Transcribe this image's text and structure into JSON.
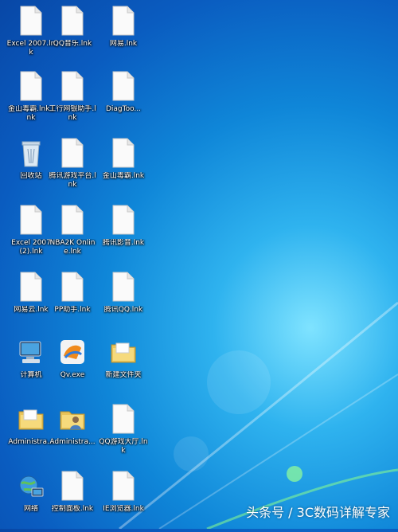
{
  "desktop": {
    "icons": [
      {
        "label": "Excel 2007.lnk",
        "icon": "blank-file-icon"
      },
      {
        "label": "QQ音乐.lnk",
        "icon": "blank-file-icon"
      },
      {
        "label": "网易.lnk",
        "icon": "blank-file-icon"
      },
      {
        "label": "金山毒霸.lnk.lnk",
        "icon": "blank-file-icon"
      },
      {
        "label": "工行网银助手.lnk",
        "icon": "blank-file-icon"
      },
      {
        "label": "DiagToo...",
        "icon": "blank-file-icon"
      },
      {
        "label": "回收站",
        "icon": "recycle-bin-icon"
      },
      {
        "label": "腾讯游戏平台.lnk",
        "icon": "blank-file-icon"
      },
      {
        "label": "金山毒霸.lnk",
        "icon": "blank-file-icon"
      },
      {
        "label": "Excel 2007 (2).lnk",
        "icon": "blank-file-icon"
      },
      {
        "label": "NBA2K Online.lnk",
        "icon": "blank-file-icon"
      },
      {
        "label": "腾讯影音.lnk",
        "icon": "blank-file-icon"
      },
      {
        "label": "网易云.lnk",
        "icon": "blank-file-icon"
      },
      {
        "label": "PP助手.lnk",
        "icon": "blank-file-icon"
      },
      {
        "label": "腾讯QQ.lnk",
        "icon": "blank-file-icon"
      },
      {
        "label": "计算机",
        "icon": "computer-icon"
      },
      {
        "label": "Qv.exe",
        "icon": "app-shortcut-icon"
      },
      {
        "label": "新建文件夹",
        "icon": "folder-icon"
      },
      {
        "label": "Administra...",
        "icon": "folder-icon"
      },
      {
        "label": "Administra...",
        "icon": "user-folder-icon"
      },
      {
        "label": "QQ游戏大厅.lnk",
        "icon": "blank-file-icon"
      },
      {
        "label": "网络",
        "icon": "network-icon"
      },
      {
        "label": "控制面板.lnk",
        "icon": "blank-file-icon"
      },
      {
        "label": "IE浏览器.lnk",
        "icon": "blank-file-icon"
      }
    ]
  },
  "watermark": "头条号 / 3C数码详解专家",
  "colors": {
    "background": "#0f86d8",
    "label_text": "#ffffff"
  }
}
